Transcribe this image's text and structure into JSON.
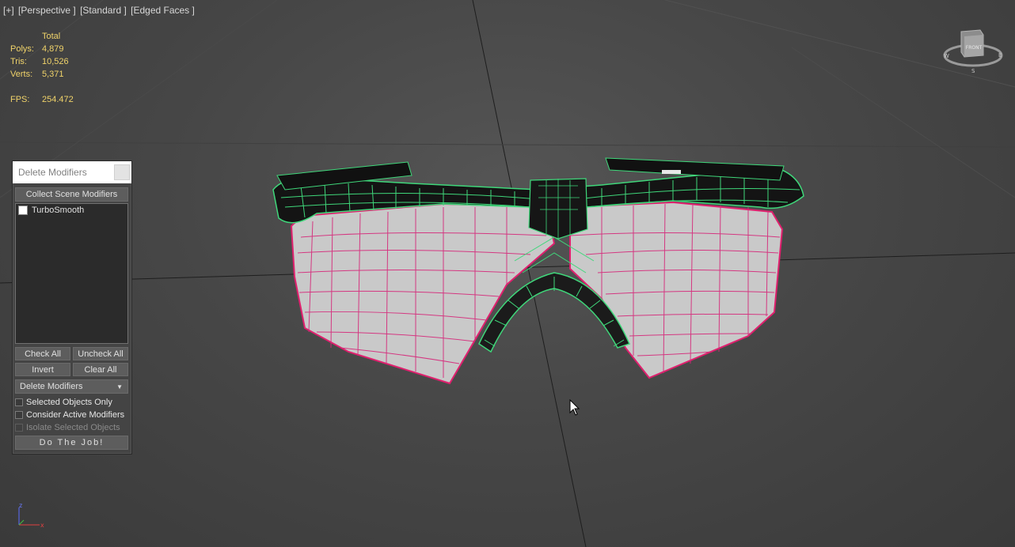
{
  "viewport": {
    "labels": [
      "[+]",
      "[Perspective ]",
      "[Standard ]",
      "[Edged Faces ]"
    ]
  },
  "stats": {
    "header": "Total",
    "rows": [
      {
        "label": "Polys:",
        "value": "4,879"
      },
      {
        "label": "Tris:",
        "value": "10,526"
      },
      {
        "label": "Verts:",
        "value": "5,371"
      }
    ],
    "fps_label": "FPS:",
    "fps_value": "254.472"
  },
  "panel": {
    "title": "Delete Modifiers",
    "collect_label": "Collect Scene Modifiers",
    "list_items": [
      {
        "label": "TurboSmooth",
        "checked": false
      }
    ],
    "check_all": "Check All",
    "uncheck_all": "Uncheck All",
    "invert": "Invert",
    "clear_all": "Clear All",
    "mode_value": "Delete Modifiers",
    "options": [
      {
        "label": "Selected Objects Only",
        "checked": false,
        "enabled": true
      },
      {
        "label": "Consider Active Modifiers",
        "checked": false,
        "enabled": true
      },
      {
        "label": "Isolate Selected Objects",
        "checked": false,
        "enabled": false
      }
    ],
    "go_label": "Do The Job!"
  },
  "viewcube": {
    "face_label": "FRONT",
    "compass": {
      "w": "W",
      "e": "E",
      "s": "S"
    }
  },
  "axis_gizmo": {
    "z": "z",
    "x": "x"
  },
  "colors": {
    "stats_text": "#f0d36a",
    "wire_green": "#3fd77a",
    "wire_pink": "#e0206e",
    "lens_gray": "#c8c8c8",
    "background": "#474747"
  }
}
